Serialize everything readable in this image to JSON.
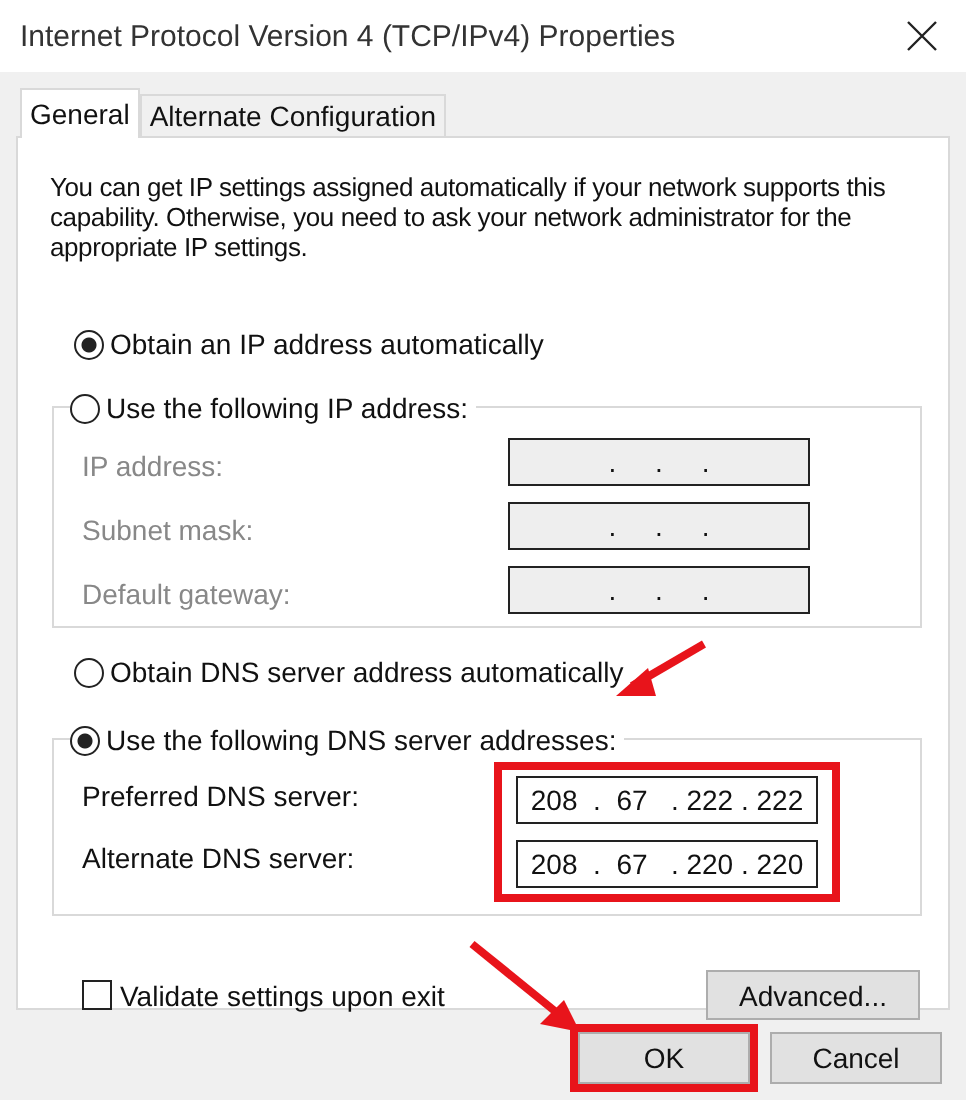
{
  "window": {
    "title": "Internet Protocol Version 4 (TCP/IPv4) Properties"
  },
  "tabs": [
    {
      "label": "General",
      "selected": true
    },
    {
      "label": "Alternate Configuration",
      "selected": false
    }
  ],
  "description": "You can get IP settings assigned automatically if your network supports this capability. Otherwise, you need to ask your network administrator for the appropriate IP settings.",
  "ip_options": [
    {
      "label": "Obtain an IP address automatically",
      "selected": true
    },
    {
      "label": "Use the following IP address:",
      "selected": false
    }
  ],
  "ip_fields": [
    {
      "label": "IP address:",
      "value": ".     .     .",
      "disabled": true
    },
    {
      "label": "Subnet mask:",
      "value": ".     .     .",
      "disabled": true
    },
    {
      "label": "Default gateway:",
      "value": ".     .     .",
      "disabled": true
    }
  ],
  "dns_options": [
    {
      "label": "Obtain DNS server address automatically",
      "selected": false
    },
    {
      "label": "Use the following DNS server addresses:",
      "selected": true
    }
  ],
  "dns_fields_highlighted": true,
  "dns_fields": [
    {
      "label": "Preferred DNS server:",
      "value": "208  .  67   . 222 . 222",
      "disabled": false
    },
    {
      "label": "Alternate DNS server:",
      "value": "208  .  67   . 220 . 220",
      "disabled": false
    }
  ],
  "validate": {
    "label": "Validate settings upon exit",
    "checked": false
  },
  "advanced_button": "Advanced...",
  "buttons": [
    {
      "label": "OK",
      "highlighted": true
    },
    {
      "label": "Cancel",
      "highlighted": false
    }
  ]
}
